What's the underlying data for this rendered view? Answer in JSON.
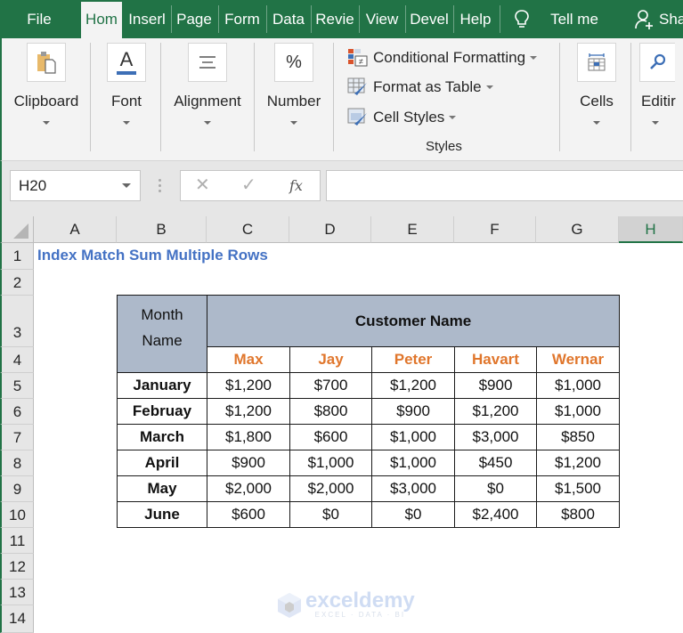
{
  "tabs": {
    "items": [
      "File",
      "Hom",
      "Inserl",
      "Page",
      "Form",
      "Data",
      "Revie",
      "View",
      "Devel",
      "Help"
    ],
    "active_index": 1,
    "tell_me": "Tell me",
    "share": "Sha"
  },
  "ribbon": {
    "clipboard": "Clipboard",
    "font": "Font",
    "alignment": "Alignment",
    "number": "Number",
    "number_icon": "%",
    "font_icon": "A",
    "conditional_formatting": "Conditional Formatting",
    "format_as_table": "Format as Table",
    "cell_styles": "Cell Styles",
    "styles_group": "Styles",
    "cells": "Cells",
    "editing": "Editir"
  },
  "formula_bar": {
    "name_box": "H20",
    "cancel": "✕",
    "enter": "✓",
    "fx": "fx",
    "value": ""
  },
  "grid": {
    "columns": [
      "A",
      "B",
      "C",
      "D",
      "E",
      "F",
      "G",
      "H"
    ],
    "selected_column": "H",
    "rows": [
      "1",
      "2",
      "3",
      "4",
      "5",
      "6",
      "7",
      "8",
      "9",
      "10",
      "11",
      "12",
      "13",
      "14"
    ]
  },
  "sheet": {
    "title": "Index Match Sum Multiple Rows",
    "table": {
      "month_header_line1": "Month",
      "month_header_line2": "Name",
      "customer_header": "Customer Name",
      "customers": [
        "Max",
        "Jay",
        "Peter",
        "Havart",
        "Wernar"
      ],
      "rows": [
        {
          "month": "January",
          "values": [
            "$1,200",
            "$700",
            "$1,200",
            "$900",
            "$1,000"
          ]
        },
        {
          "month": "Februay",
          "values": [
            "$1,200",
            "$800",
            "$900",
            "$1,200",
            "$1,000"
          ]
        },
        {
          "month": "March",
          "values": [
            "$1,800",
            "$600",
            "$1,000",
            "$3,000",
            "$850"
          ]
        },
        {
          "month": "April",
          "values": [
            "$900",
            "$1,000",
            "$1,000",
            "$450",
            "$1,200"
          ]
        },
        {
          "month": "May",
          "values": [
            "$2,000",
            "$2,000",
            "$3,000",
            "$0",
            "$1,500"
          ]
        },
        {
          "month": "June",
          "values": [
            "$600",
            "$0",
            "$0",
            "$2,400",
            "$800"
          ]
        }
      ]
    }
  },
  "watermark": {
    "brand": "exceldemy",
    "tagline": "EXCEL · DATA · BI"
  },
  "colors": {
    "excel_green": "#217346",
    "title_blue": "#4472c4",
    "header_fill": "#adb9ca",
    "customer_orange": "#e0762c"
  }
}
